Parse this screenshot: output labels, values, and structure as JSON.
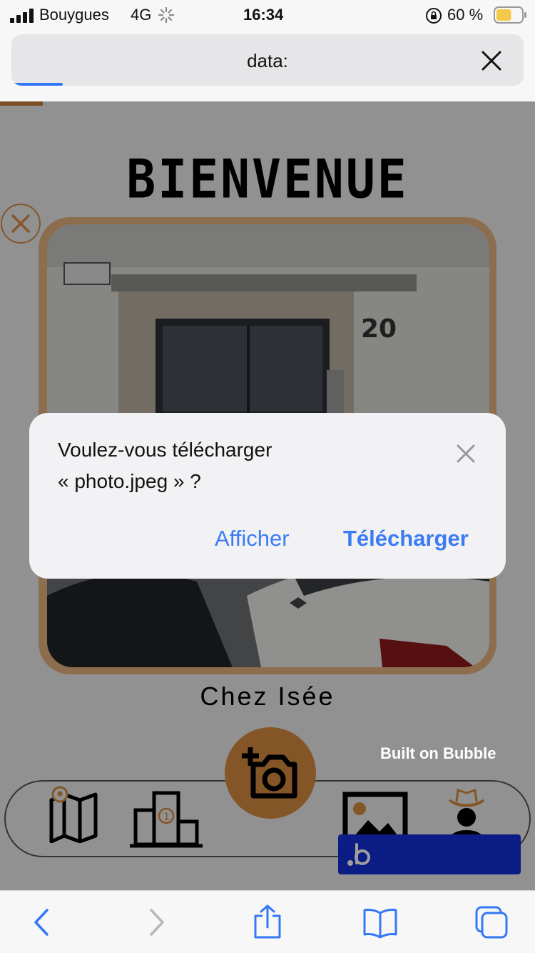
{
  "status_bar": {
    "carrier": "Bouygues",
    "network": "4G",
    "time": "16:34",
    "battery": "60 %",
    "battery_level": 0.6,
    "battery_color": "#f7c948"
  },
  "browser": {
    "url": "data:",
    "close_icon": "close-icon",
    "progress_fraction": 0.1,
    "progress_color": "#3478f6"
  },
  "page": {
    "title": "BIENVENUE",
    "place_name": "Chez Isée",
    "photo_house_number": "20",
    "accent_color": "#d68a3f",
    "nav": {
      "items": [
        "map-pin-icon",
        "ranking-podium-icon",
        "camera-add-icon",
        "gallery-icon",
        "cowboy-avatar-icon"
      ]
    },
    "badge": {
      "label": "Built on Bubble",
      "color": "#1330d6"
    }
  },
  "dialog": {
    "line1": "Voulez-vous télécharger",
    "line2": "« photo.jpeg » ?",
    "view_label": "Afficher",
    "download_label": "Télécharger"
  },
  "toolbar": {
    "items": [
      "back-icon",
      "forward-icon",
      "share-icon",
      "bookmarks-icon",
      "tabs-icon"
    ]
  }
}
